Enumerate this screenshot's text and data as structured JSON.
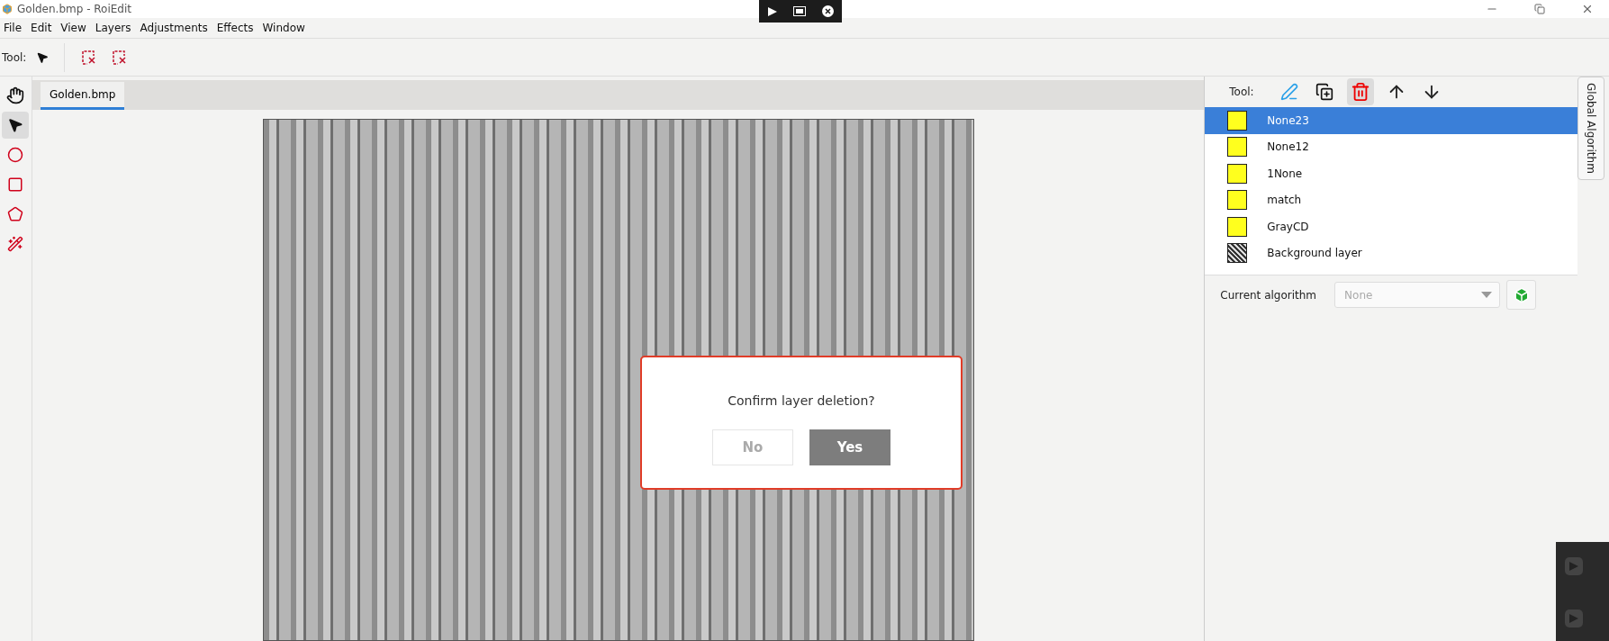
{
  "window": {
    "title": "Golden.bmp - RoiEdit"
  },
  "menu": [
    "File",
    "Edit",
    "View",
    "Layers",
    "Adjustments",
    "Effects",
    "Window"
  ],
  "toolbar": {
    "label": "Tool:"
  },
  "side_tools": [
    {
      "kind": "hand",
      "selected": false
    },
    {
      "kind": "pointer",
      "selected": true
    },
    {
      "kind": "circle",
      "selected": false
    },
    {
      "kind": "square",
      "selected": false
    },
    {
      "kind": "polygon",
      "selected": false
    },
    {
      "kind": "wand",
      "selected": false
    }
  ],
  "document_tabs": [
    {
      "label": "Golden.bmp",
      "selected": true
    }
  ],
  "layers_panel": {
    "tool_label": "Tool:",
    "layers": [
      {
        "name": "None23",
        "kind": "fill",
        "selected": true
      },
      {
        "name": "None12",
        "kind": "fill",
        "selected": false
      },
      {
        "name": "1None",
        "kind": "fill",
        "selected": false
      },
      {
        "name": "match",
        "kind": "fill",
        "selected": false
      },
      {
        "name": "GrayCD",
        "kind": "fill",
        "selected": false
      },
      {
        "name": "Background layer",
        "kind": "image",
        "selected": false
      }
    ]
  },
  "algorithm": {
    "label": "Current algorithm",
    "value": "None"
  },
  "side_tab": {
    "label": "Global Algorithm"
  },
  "dialog": {
    "message": "Confirm layer deletion?",
    "buttons": [
      {
        "label": "No",
        "kind": "secondary"
      },
      {
        "label": "Yes",
        "kind": "primary"
      }
    ]
  }
}
